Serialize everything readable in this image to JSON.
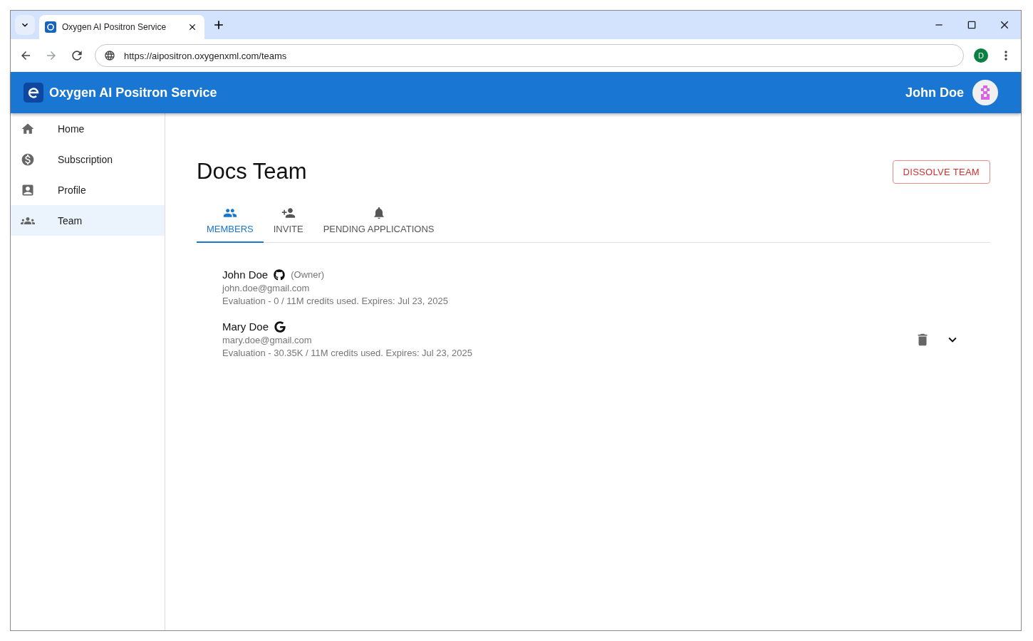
{
  "browser": {
    "tab_title": "Oxygen AI Positron Service",
    "url": "https://aipositron.oxygenxml.com/teams",
    "profile_initial": "D"
  },
  "header": {
    "title": "Oxygen AI Positron Service",
    "user_name": "John Doe"
  },
  "sidebar": {
    "items": [
      {
        "label": "Home",
        "kind": "home",
        "selected": false
      },
      {
        "label": "Subscription",
        "kind": "subscription",
        "selected": false
      },
      {
        "label": "Profile",
        "kind": "profile",
        "selected": false
      },
      {
        "label": "Team",
        "kind": "team",
        "selected": true
      }
    ]
  },
  "team": {
    "name": "Docs Team",
    "dissolve_button": "DISSOLVE TEAM"
  },
  "tabs": [
    {
      "label": "MEMBERS",
      "kind": "members",
      "selected": true
    },
    {
      "label": "INVITE",
      "kind": "invite",
      "selected": false
    },
    {
      "label": "PENDING APPLICATIONS",
      "kind": "pending",
      "selected": false
    }
  ],
  "members": [
    {
      "name": "John Doe",
      "kind": "github",
      "role": "(Owner)",
      "email": "john.doe@gmail.com",
      "usage": "Evaluation - 0 / 11M credits used. Expires: Jul 23, 2025",
      "removable": false
    },
    {
      "name": "Mary Doe",
      "kind": "google",
      "email": "mary.doe@gmail.com",
      "usage": "Evaluation - 30.35K / 11M credits used. Expires: Jul 23, 2025",
      "removable": true
    }
  ]
}
